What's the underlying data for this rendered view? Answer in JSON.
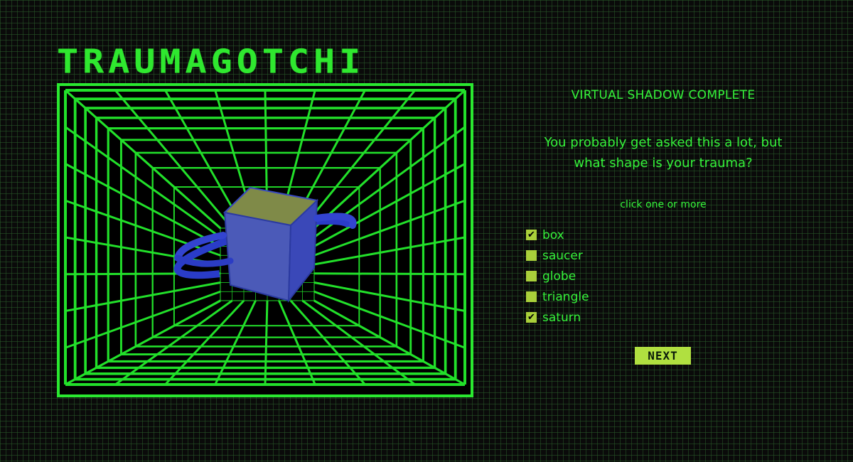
{
  "app": {
    "title": "TRAUMAGOTCHI"
  },
  "panel": {
    "heading": "VIRTUAL SHADOW COMPLETE",
    "question_line1": "You probably get asked this a lot, but",
    "question_line2": "what shape is your trauma?",
    "hint": "click one or more",
    "next_label": "NEXT"
  },
  "options": [
    {
      "label": "box",
      "checked": true
    },
    {
      "label": "saucer",
      "checked": false
    },
    {
      "label": "globe",
      "checked": false
    },
    {
      "label": "triangle",
      "checked": false
    },
    {
      "label": "saturn",
      "checked": true
    }
  ],
  "colors": {
    "grid_green": "#2ae830",
    "text_green": "#35f23a",
    "checkbox": "#a9cf3a",
    "button": "#b0e040",
    "shape_blue": "#3b4ed8",
    "shape_olive": "#8c8f3a"
  },
  "icons": {
    "check": "checkmark-icon"
  }
}
